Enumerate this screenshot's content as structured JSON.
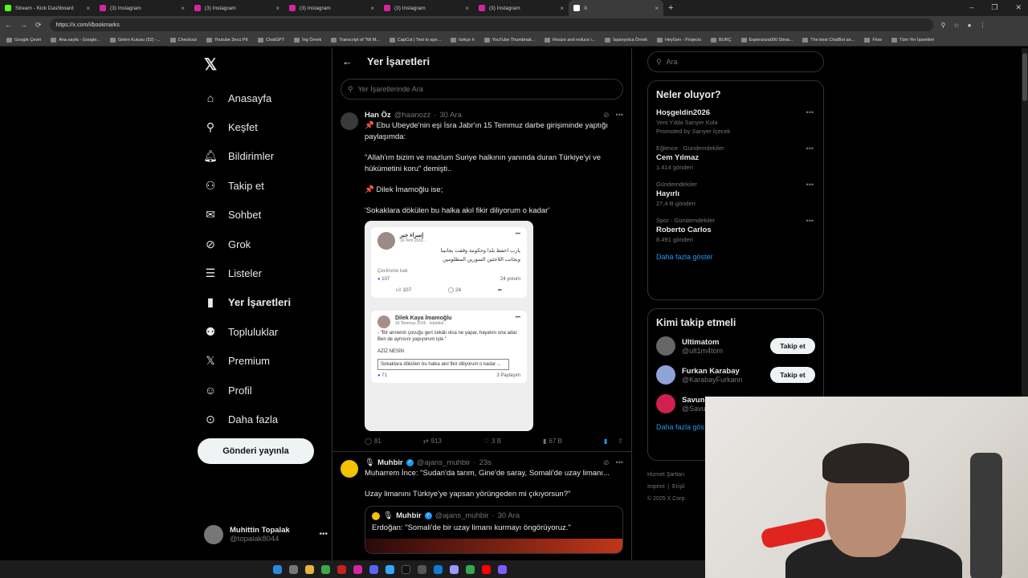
{
  "browser": {
    "tabs": [
      {
        "title": "Stream - Kick Dashboard",
        "color": "#53fc18"
      },
      {
        "title": "(3) Instagram",
        "color": "#d6249f"
      },
      {
        "title": "(3) Instagram",
        "color": "#d6249f"
      },
      {
        "title": "(3) Instagram",
        "color": "#d6249f"
      },
      {
        "title": "(3) Instagram",
        "color": "#d6249f"
      },
      {
        "title": "(3) Instagram",
        "color": "#d6249f"
      },
      {
        "title": "X",
        "color": "#ffffff"
      }
    ],
    "url": "https://x.com/i/bookmarks",
    "bookmarks": [
      "Google Çeviri",
      "Ana sayfa - Google...",
      "Gelen Kutusu (52) -...",
      "Checkout",
      "Youtube 3ncü PK",
      "ChatGPT",
      "İng Örnek",
      "Transcript of \"MI M...",
      "CapCut | Text to spe...",
      "türkçe h",
      "YouTube Thumbnail...",
      "Resize and reduce i...",
      "İspanyolca Örnek",
      "HeyGen - Projects",
      "BURÇ",
      "Esperanza000 Strea...",
      "The best ChatBot an...",
      "Flow",
      "Tüm Yer İşaretleri"
    ]
  },
  "sidebar": {
    "items": [
      {
        "label": "Anasayfa",
        "icon": "home-icon",
        "glyph": "⌂"
      },
      {
        "label": "Keşfet",
        "icon": "search-icon",
        "glyph": "⚲"
      },
      {
        "label": "Bildirimler",
        "icon": "bell-icon",
        "glyph": "🔔︎"
      },
      {
        "label": "Takip et",
        "icon": "follow-icon",
        "glyph": "⚇"
      },
      {
        "label": "Sohbet",
        "icon": "mail-icon",
        "glyph": "✉"
      },
      {
        "label": "Grok",
        "icon": "grok-icon",
        "glyph": "⊘"
      },
      {
        "label": "Listeler",
        "icon": "list-icon",
        "glyph": "☰"
      },
      {
        "label": "Yer İşaretleri",
        "icon": "bookmark-icon",
        "glyph": "▮"
      },
      {
        "label": "Topluluklar",
        "icon": "communities-icon",
        "glyph": "⚉"
      },
      {
        "label": "Premium",
        "icon": "x-premium-icon",
        "glyph": "𝕏"
      },
      {
        "label": "Profil",
        "icon": "profile-icon",
        "glyph": "☺"
      },
      {
        "label": "Daha fazla",
        "icon": "more-circle-icon",
        "glyph": "⊙"
      }
    ],
    "post_button": "Gönderi yayınla",
    "account": {
      "name": "Muhittin Topalak",
      "handle": "@topalak8044"
    }
  },
  "main": {
    "title": "Yer İşaretleri",
    "search_placeholder": "Yer İşaretlerinde Ara",
    "tweet1": {
      "name": "Han Öz",
      "handle": "@haanozz",
      "time": "30 Ara",
      "lines": [
        "📌 Ebu Ubeyde'nin eşi İsra Jabr'ın 15 Temmuz darbe girişiminde yaptığı",
        "paylaşımda:",
        "",
        "\"Allah'ım bizim ve mazlum Suriye halkının yanında duran Türkiye'yi ve",
        "hükümetini koru\" demişti..",
        "",
        "📌 Dilek İmamoğlu ise;",
        "",
        "'Sokaklara dökülen bu halka akıl fikir diliyorum o kadar'"
      ],
      "card1": {
        "name": "إسراء جبر",
        "date": "16 Tem 2016 ·",
        "text1": "يارب احفظ بلدا وحكومة وقفت بجانبنا",
        "text2": "وبجانب اللاجئين السورين المظلومين",
        "translate": "Çevirisine bak",
        "likes": "107",
        "comments": "24 yorum",
        "act_like": "107",
        "act_comment": "24"
      },
      "card2": {
        "name": "Dilek Kaya İmamoğlu",
        "date": "16 Temmuz 2016 · İstanbul ·",
        "text": "- \"Bir annenin çocuğu geri zekâlı olsa ne yapar, hayatını ona adar. Ben de aynısını yapıyorum işte.\"",
        "author": "AZİZ NESİN",
        "quote": "Sokaklara dökülen bu halka akıl fikir diliyorum o kadar ...",
        "reactions": "71",
        "shares": "3 Paylaşım"
      },
      "stats": {
        "replies": "81",
        "reposts": "913",
        "likes": "3 B",
        "views": "67 B"
      }
    },
    "tweet2": {
      "name": "Muhbir",
      "handle": "@ajans_muhbir",
      "time": "23s",
      "line1": "Muharrem İnce: \"Sudan'da tarım, Gine'de saray, Somali'de uzay limanı...",
      "line2": "Uzay limanını Türkiye'ye yapsan yörüngeden mi çıkıyorsun?\"",
      "quote": {
        "name": "Muhbir",
        "handle": "@ajans_muhbir",
        "time": "30 Ara",
        "text": "Erdoğan: \"Somali'de bir uzay limanı kurmayı öngörüyoruz.\""
      }
    }
  },
  "right": {
    "search_placeholder": "Ara",
    "trends_title": "Neler oluyor?",
    "trends": [
      {
        "category": "",
        "name": "Hoşgeldin2026",
        "count": "Yeni Yılda Sarıyer Kola",
        "promo": "Promoted by Sarıyer İçecek"
      },
      {
        "category": "Eğlence · Gündemdekiler",
        "name": "Cem Yılmaz",
        "count": "1.414 gönderi",
        "promo": ""
      },
      {
        "category": "Gündemdekiler",
        "name": "Hayırlı",
        "count": "27,4 B gönderi",
        "promo": ""
      },
      {
        "category": "Spor · Gündemdekiler",
        "name": "Roberto Carlos",
        "count": "8.491 gönderi",
        "promo": ""
      }
    ],
    "show_more": "Daha fazla göster",
    "who_title": "Kimi takip etmeli",
    "who": [
      {
        "name": "Ultimatom",
        "handle": "@ult1m4tom",
        "button": "Takip et"
      },
      {
        "name": "Furkan Karabay",
        "handle": "@KarabayFurkann",
        "button": "Takip et"
      },
      {
        "name": "Savunı",
        "handle": "@Savuı",
        "button": ""
      }
    ],
    "who_more": "Daha fazla gös",
    "footer1": "Hizmet Şartları",
    "footer2": "Imprint",
    "footer3": "Erişil",
    "footer4": "© 2025 X Corp."
  }
}
